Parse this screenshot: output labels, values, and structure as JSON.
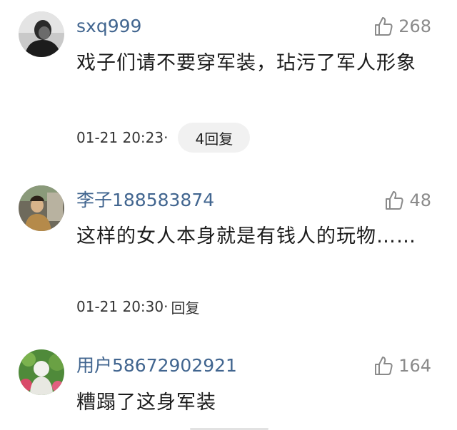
{
  "comments": [
    {
      "username": "sxq999",
      "likes": "268",
      "text": "戏子们请不要穿军装，玷污了军人形象",
      "timestamp": "01-21 20:23",
      "separator": "·",
      "reply_label": "4回复"
    },
    {
      "username": "李子188583874",
      "likes": "48",
      "text": "这样的女人本身就是有钱人的玩物……",
      "timestamp": "01-21 20:30",
      "separator": "·",
      "reply_label": "回复"
    },
    {
      "username": "用户58672902921",
      "likes": "164",
      "text": "糟蹋了这身军装"
    }
  ]
}
